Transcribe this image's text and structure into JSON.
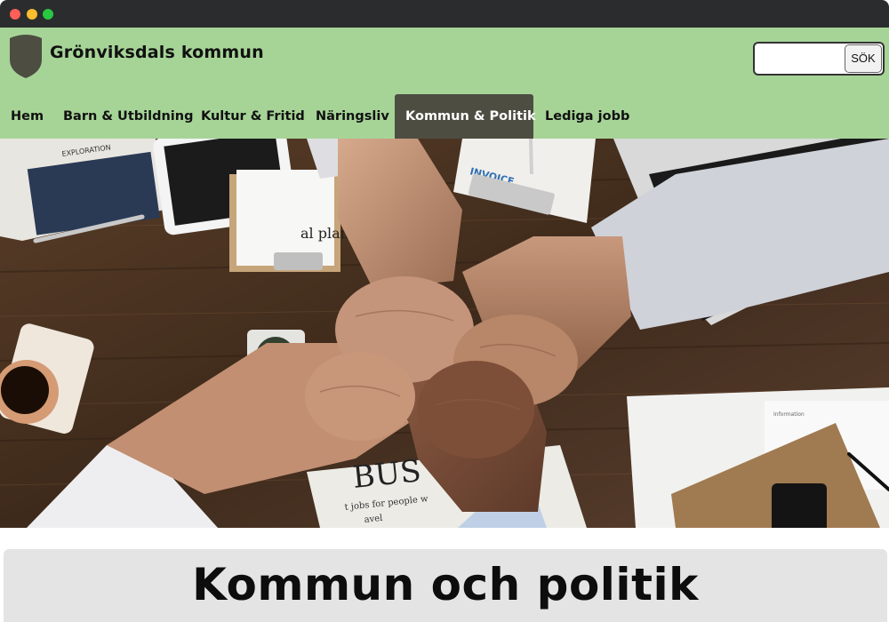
{
  "window": {
    "controls": [
      "close",
      "minimize",
      "maximize"
    ]
  },
  "header": {
    "site_name": "Grönviksdals kommun",
    "logo_icon": "shield-icon",
    "search": {
      "value": "",
      "placeholder": "",
      "button_label": "SÖK"
    }
  },
  "nav": {
    "items": [
      {
        "label": "Hem"
      },
      {
        "label": "Barn & Utbildning"
      },
      {
        "label": "Kultur & Fritid"
      },
      {
        "label": "Näringsliv"
      },
      {
        "label": "Kommun & Politik",
        "active": true
      },
      {
        "label": "Lediga jobb"
      }
    ]
  },
  "hero": {
    "image_texts": [
      "BUS",
      "INVOICE",
      "al plan",
      "EXPLORATION",
      "t jobs for people w",
      "avel"
    ]
  },
  "main": {
    "page_title": "Kommun och politik"
  },
  "colors": {
    "header_bg": "#a6d497",
    "nav_active_bg": "#4d4d42",
    "title_box_bg": "#e4e4e4",
    "titlebar_bg": "#2b2c2e"
  }
}
